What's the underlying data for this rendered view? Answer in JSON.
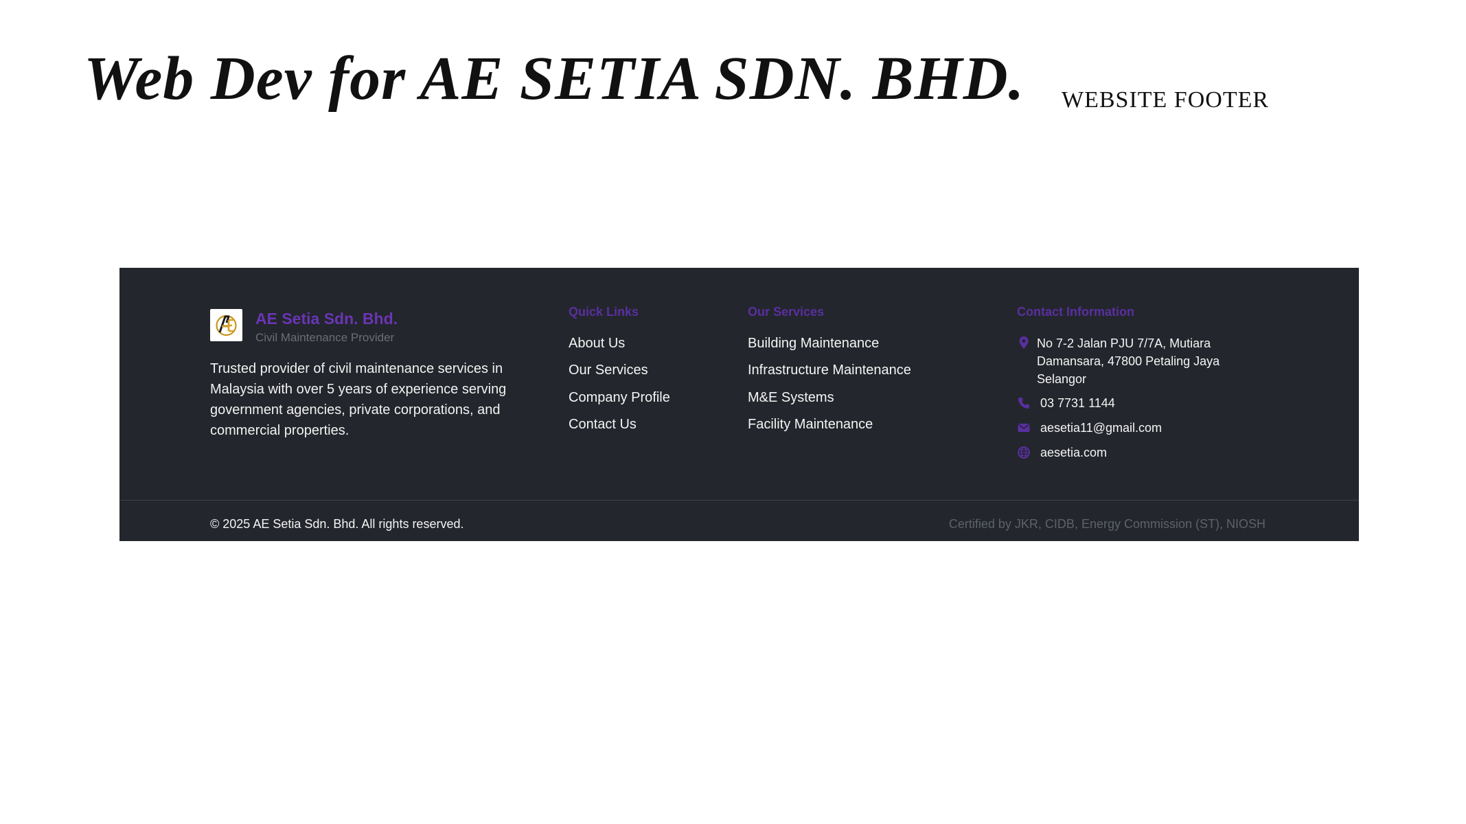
{
  "slide": {
    "title": "Web Dev for AE SETIA SDN. BHD.",
    "subtitle": "WEBSITE FOOTER"
  },
  "footer": {
    "brand": {
      "name": "AE Setia Sdn. Bhd.",
      "tagline": "Civil Maintenance Provider",
      "logo_icon": "ae-logo-icon"
    },
    "about": "Trusted provider of civil maintenance services in Malaysia with over 5 years of experience serving government agencies, private corporations, and commercial properties.",
    "quick_links": {
      "heading": "Quick Links",
      "items": [
        "About Us",
        "Our Services",
        "Company Profile",
        "Contact Us"
      ]
    },
    "services": {
      "heading": "Our Services",
      "items": [
        "Building Maintenance",
        "Infrastructure Maintenance",
        "M&E Systems",
        "Facility Maintenance"
      ]
    },
    "contact": {
      "heading": "Contact Information",
      "address": "No 7-2 Jalan PJU 7/7A, Mutiara Damansara, 47800 Petaling Jaya Selangor",
      "phone": "03 7731 1144",
      "email": "aesetia11@gmail.com",
      "website": "aesetia.com",
      "icons": [
        "map-pin-icon",
        "phone-icon",
        "mail-icon",
        "globe-icon"
      ]
    },
    "copyright": "© 2025 AE Setia Sdn. Bhd. All rights reserved.",
    "certifications": "Certified by JKR, CIDB, Energy Commission (ST), NIOSH"
  },
  "colors": {
    "footer_bg": "#23262c",
    "accent": "#6a35b5",
    "heading": "#5a2fa0",
    "muted": "#5e6269",
    "text": "#f5f5f5"
  }
}
